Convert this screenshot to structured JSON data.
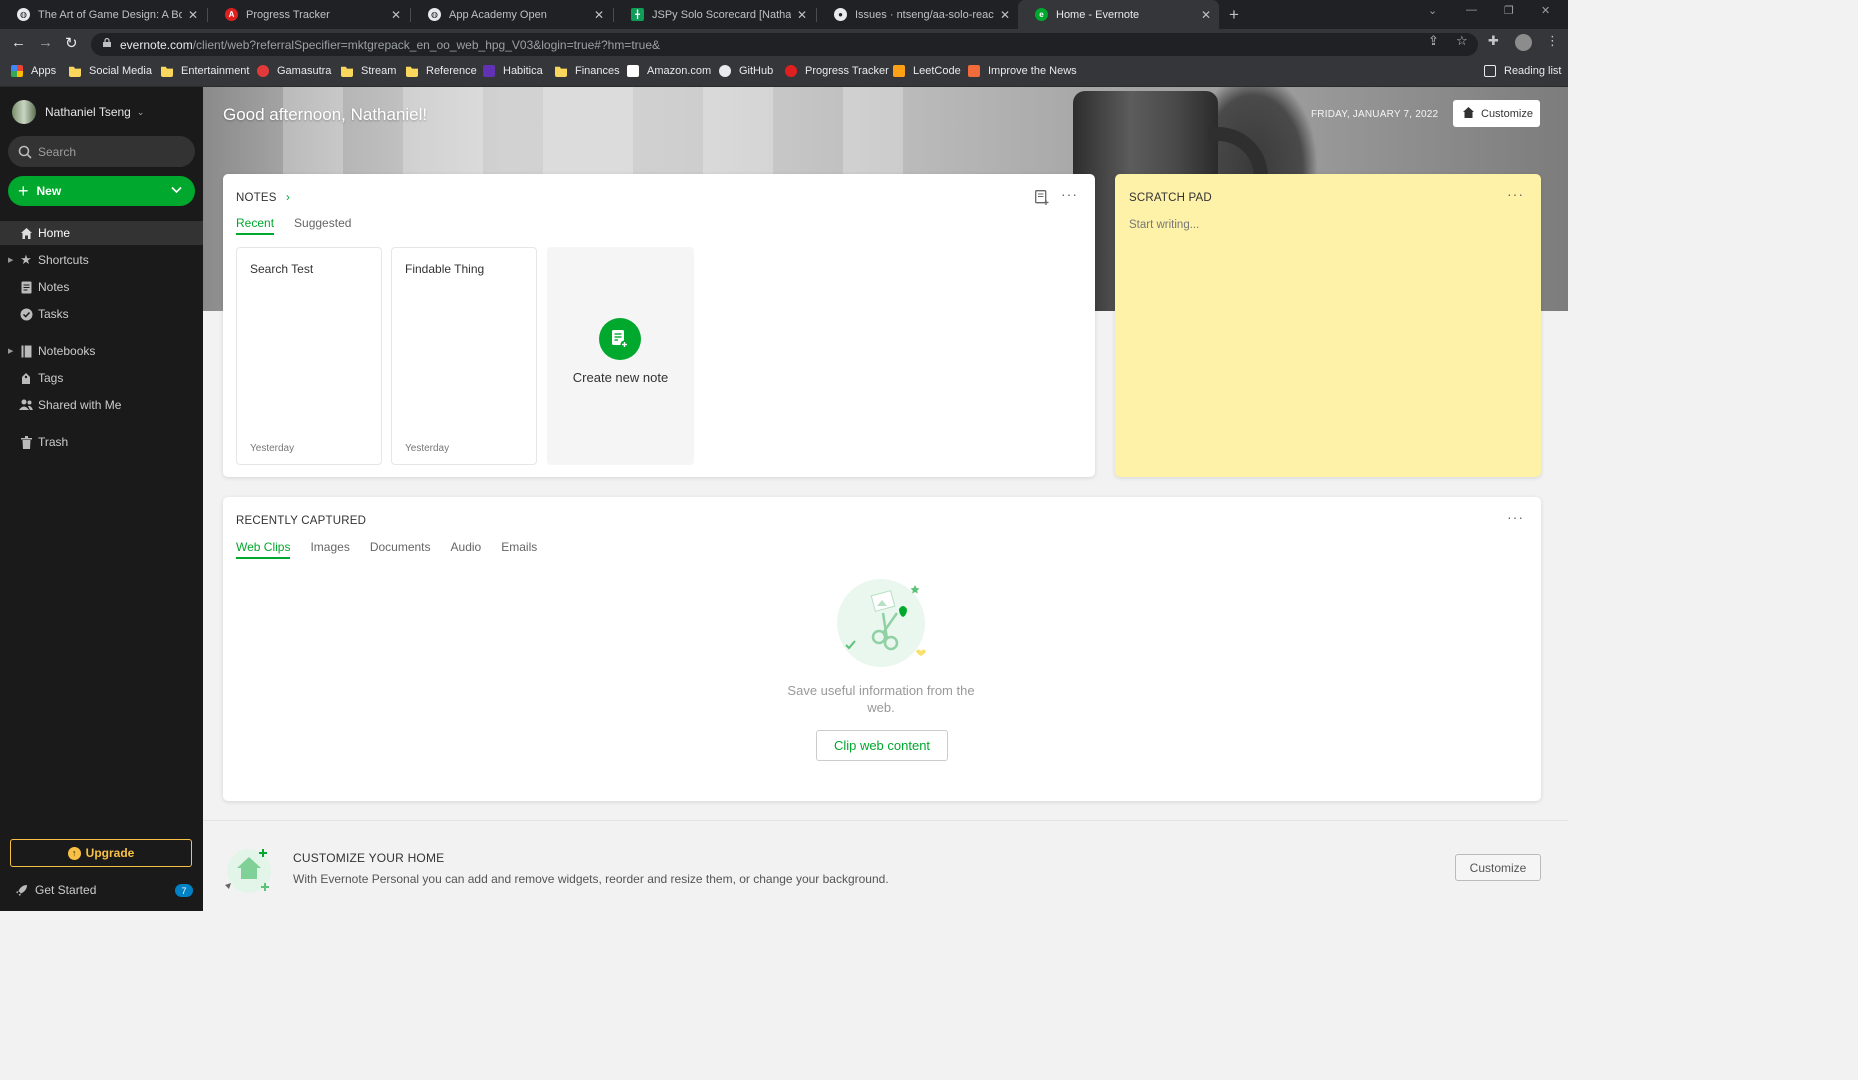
{
  "browser": {
    "tabs": [
      {
        "title": "The Art of Game Design: A Book",
        "icon": "globe-icon",
        "active": false
      },
      {
        "title": "Progress Tracker",
        "icon": "red-a-icon",
        "active": false
      },
      {
        "title": "App Academy Open",
        "icon": "globe-icon",
        "active": false
      },
      {
        "title": "JSPy Solo Scorecard [Nathaniel T",
        "icon": "sheets-icon",
        "active": false
      },
      {
        "title": "Issues · ntseng/aa-solo-react-pro",
        "icon": "github-icon",
        "active": false
      },
      {
        "title": "Home - Evernote",
        "icon": "evernote-icon",
        "active": true
      }
    ],
    "url_host": "evernote.com",
    "url_path": "/client/web?referralSpecifier=mktgrepack_en_oo_web_hpg_V03&login=true#?hm=true&",
    "bookmarks": [
      {
        "label": "Apps",
        "icon": "apps-grid-icon"
      },
      {
        "label": "Social Media",
        "icon": "folder-icon"
      },
      {
        "label": "Entertainment",
        "icon": "folder-icon"
      },
      {
        "label": "Gamasutra",
        "icon": "gamasutra-icon"
      },
      {
        "label": "Stream",
        "icon": "folder-icon"
      },
      {
        "label": "Reference",
        "icon": "folder-icon"
      },
      {
        "label": "Habitica",
        "icon": "habitica-icon"
      },
      {
        "label": "Finances",
        "icon": "folder-icon"
      },
      {
        "label": "Amazon.com",
        "icon": "amazon-icon"
      },
      {
        "label": "GitHub",
        "icon": "github-icon"
      },
      {
        "label": "Progress Tracker",
        "icon": "red-a-icon"
      },
      {
        "label": "LeetCode",
        "icon": "leetcode-icon"
      },
      {
        "label": "Improve the News",
        "icon": "improve-news-icon"
      }
    ],
    "reading_list": "Reading list"
  },
  "sidebar": {
    "user_name": "Nathaniel Tseng",
    "search_label": "Search",
    "new_label": "New",
    "items": [
      {
        "label": "Home",
        "icon": "home-icon"
      },
      {
        "label": "Shortcuts",
        "icon": "star-icon"
      },
      {
        "label": "Notes",
        "icon": "note-icon"
      },
      {
        "label": "Tasks",
        "icon": "check-circle-icon"
      },
      {
        "label": "Notebooks",
        "icon": "notebook-icon"
      },
      {
        "label": "Tags",
        "icon": "tag-icon"
      },
      {
        "label": "Shared with Me",
        "icon": "people-icon"
      },
      {
        "label": "Trash",
        "icon": "trash-icon"
      }
    ],
    "upgrade_label": "Upgrade",
    "get_started_label": "Get Started",
    "get_started_count": "7"
  },
  "home": {
    "greeting": "Good afternoon, Nathaniel!",
    "date": "FRIDAY, JANUARY 7, 2022",
    "customize_label": "Customize",
    "notes_widget": {
      "title": "NOTES",
      "tabs": [
        "Recent",
        "Suggested"
      ],
      "notes": [
        {
          "title": "Search Test",
          "date": "Yesterday"
        },
        {
          "title": "Findable Thing",
          "date": "Yesterday"
        }
      ],
      "create_label": "Create new note"
    },
    "scratch_pad": {
      "title": "SCRATCH PAD",
      "placeholder": "Start writing..."
    },
    "recently_captured": {
      "title": "RECENTLY CAPTURED",
      "tabs": [
        "Web Clips",
        "Images",
        "Documents",
        "Audio",
        "Emails"
      ],
      "empty_text": "Save useful information from the web.",
      "clip_button": "Clip web content"
    },
    "customize_banner": {
      "title": "CUSTOMIZE YOUR HOME",
      "description": "With Evernote Personal you can add and remove widgets, reorder and resize them, or change your background.",
      "button": "Customize"
    }
  },
  "colors": {
    "accent": "#00a82d",
    "sidebar_bg": "#1a1a1a",
    "scratch_bg": "#fef1a8",
    "upgrade": "#f8c146",
    "badge": "#0081c6"
  }
}
